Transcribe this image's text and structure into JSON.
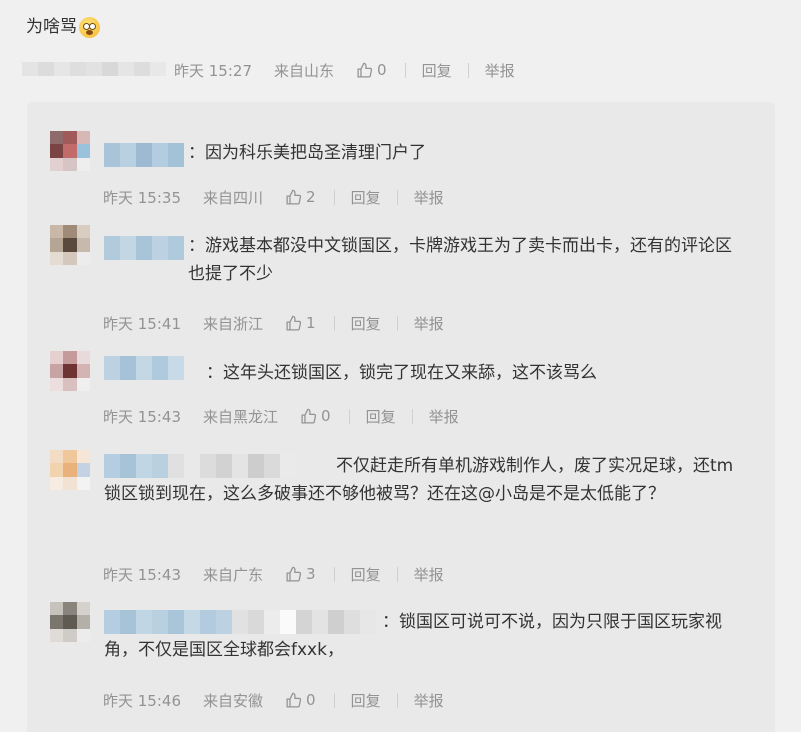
{
  "root": {
    "text": "为啥骂",
    "emoji": "astonished-face-emoji",
    "time": "昨天 15:27",
    "location": "来自山东",
    "likes": "0",
    "reply_label": "回复",
    "report_label": "举报"
  },
  "replies": [
    {
      "text": "：因为科乐美把岛圣清理门户了",
      "time": "昨天 15:35",
      "location": "来自四川",
      "likes": "2",
      "reply_label": "回复",
      "report_label": "举报"
    },
    {
      "text": "：游戏基本都没中文锁国区，卡牌游戏王为了卖卡而出卡，还有的评论区也提了不少",
      "time": "昨天 15:41",
      "location": "来自浙江",
      "likes": "1",
      "reply_label": "回复",
      "report_label": "举报"
    },
    {
      "text": "：这年头还锁国区，锁完了现在又来舔，这不该骂么",
      "time": "昨天 15:43",
      "location": "来自黑龙江",
      "likes": "0",
      "reply_label": "回复",
      "report_label": "举报"
    },
    {
      "text": "不仅赶走所有单机游戏制作人，废了实况足球，还tm锁区锁到现在，这么多破事还不够他被骂？还在这@小岛是不是太低能了？",
      "time": "昨天 15:43",
      "location": "来自广东",
      "likes": "3",
      "reply_label": "回复",
      "report_label": "举报"
    },
    {
      "text": "：锁国区可说可不说，因为只限于国区玩家视角，不仅是国区全球都会fxxk，",
      "time": "昨天 15:46",
      "location": "来自安徽",
      "likes": "0",
      "reply_label": "回复",
      "report_label": "举报"
    }
  ],
  "colors": {
    "meta_gray": "#939393",
    "text": "#333333",
    "reply_bg": "#e9e9e9",
    "page_bg": "#f0f0f0"
  },
  "icons": {
    "like": "thumbs-up-icon"
  }
}
